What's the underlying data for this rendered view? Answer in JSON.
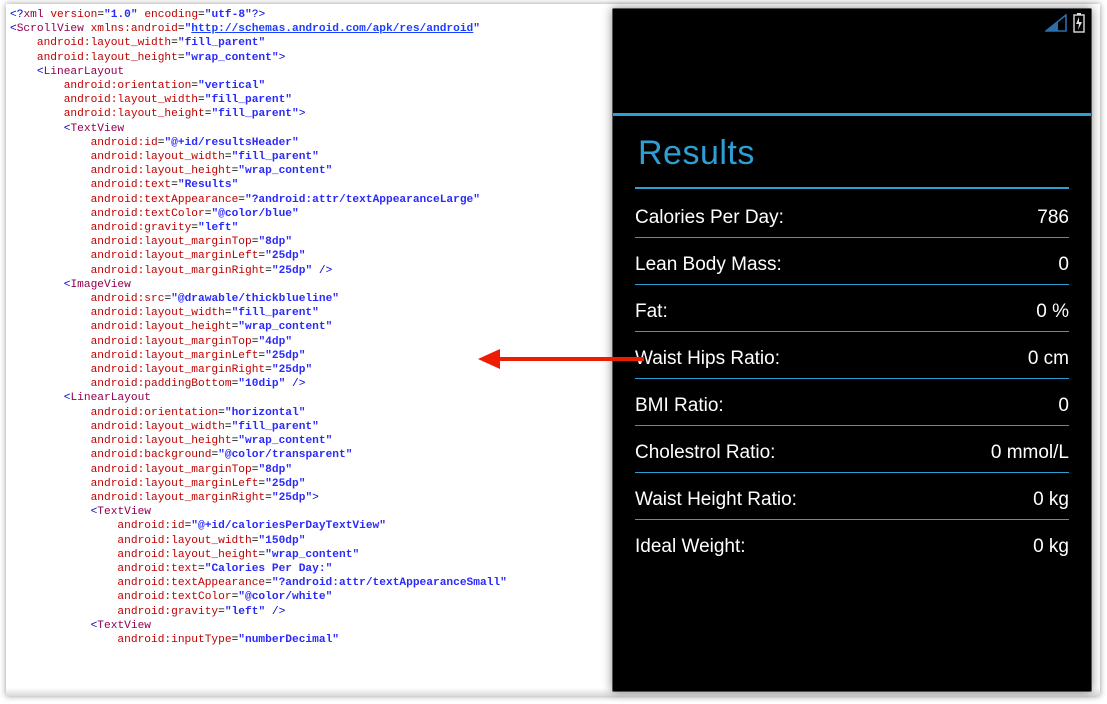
{
  "xml": {
    "declaration": "<?xml version=\"1.0\" encoding=\"utf-8\"?>",
    "ns_url": "http://schemas.android.com/apk/res/android",
    "scrollview_width": "fill_parent",
    "scrollview_height": "wrap_content",
    "ll1_orientation": "vertical",
    "ll1_width": "fill_parent",
    "ll1_height": "fill_parent",
    "tv1_id": "@+id/resultsHeader",
    "tv1_width": "fill_parent",
    "tv1_height": "wrap_content",
    "tv1_text": "Results",
    "tv1_appearance": "?android:attr/textAppearanceLarge",
    "tv1_color": "@color/blue",
    "tv1_gravity": "left",
    "tv1_mt": "8dp",
    "tv1_ml": "25dp",
    "tv1_mr": "25dp",
    "iv_src": "@drawable/thickblueline",
    "iv_width": "fill_parent",
    "iv_height": "wrap_content",
    "iv_mt": "4dp",
    "iv_ml": "25dp",
    "iv_mr": "25dp",
    "iv_pb": "10dip",
    "ll2_orientation": "horizontal",
    "ll2_width": "fill_parent",
    "ll2_height": "wrap_content",
    "ll2_bg": "@color/transparent",
    "ll2_mt": "8dp",
    "ll2_ml": "25dp",
    "ll2_mr": "25dp",
    "tv2_id": "@+id/caloriesPerDayTextView",
    "tv2_width": "150dp",
    "tv2_height": "wrap_content",
    "tv2_text": "Calories Per Day:",
    "tv2_appearance": "?android:attr/textAppearanceSmall",
    "tv2_color": "@color/white",
    "tv2_gravity": "left",
    "tv3_input": "numberDecimal"
  },
  "results": {
    "title": "Results",
    "rows": [
      {
        "label": "Calories Per Day:",
        "value": "786"
      },
      {
        "label": "Lean Body Mass:",
        "value": "0"
      },
      {
        "label": "Fat:",
        "value": "0 %"
      },
      {
        "label": "Waist Hips Ratio:",
        "value": "0 cm"
      },
      {
        "label": "BMI Ratio:",
        "value": "0"
      },
      {
        "label": "Cholestrol Ratio:",
        "value": "0 mmol/L"
      },
      {
        "label": "Waist Height Ratio:",
        "value": "0 kg"
      },
      {
        "label": "Ideal Weight:",
        "value": "0 kg"
      }
    ]
  }
}
